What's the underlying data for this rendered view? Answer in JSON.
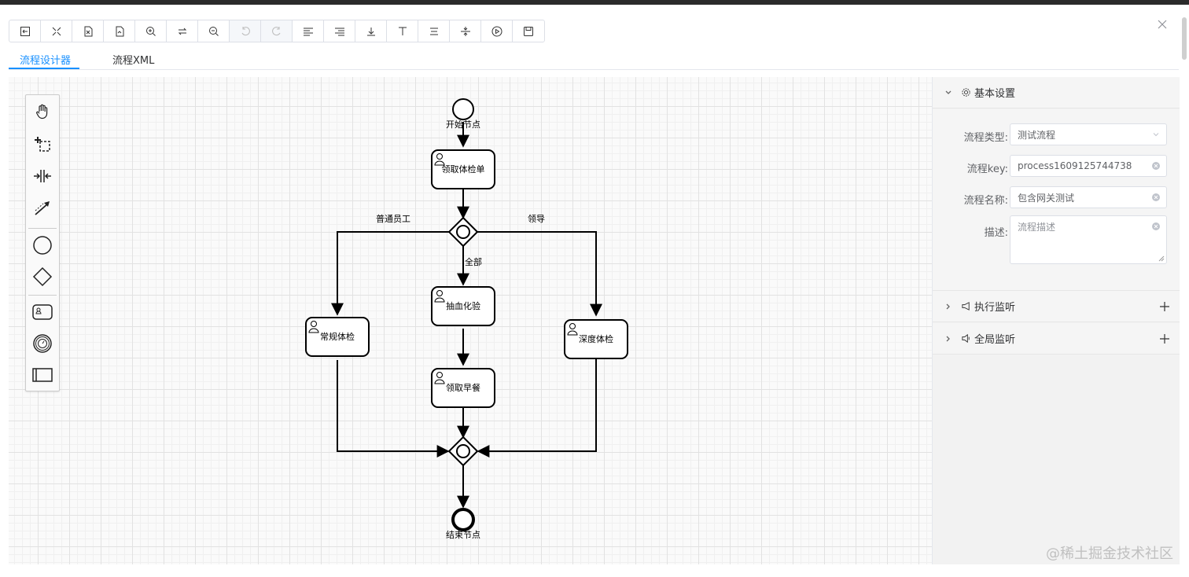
{
  "toolbar": {
    "buttons": [
      {
        "icon": "open-file-icon",
        "disabled": false
      },
      {
        "icon": "fit-view-icon",
        "disabled": false
      },
      {
        "icon": "download-xml-icon",
        "disabled": false
      },
      {
        "icon": "download-svg-icon",
        "disabled": false
      },
      {
        "icon": "zoom-in-icon",
        "disabled": false
      },
      {
        "icon": "reset-zoom-icon",
        "disabled": false
      },
      {
        "icon": "zoom-out-icon",
        "disabled": false
      },
      {
        "icon": "undo-icon",
        "disabled": true
      },
      {
        "icon": "redo-icon",
        "disabled": true
      },
      {
        "icon": "align-left-icon",
        "disabled": false
      },
      {
        "icon": "align-right-icon",
        "disabled": false
      },
      {
        "icon": "align-bottom-icon",
        "disabled": false
      },
      {
        "icon": "align-top-icon",
        "disabled": false
      },
      {
        "icon": "align-center-icon",
        "disabled": false
      },
      {
        "icon": "align-middle-icon",
        "disabled": false
      },
      {
        "icon": "simulate-icon",
        "disabled": false
      },
      {
        "icon": "save-icon",
        "disabled": false
      }
    ]
  },
  "tabs": {
    "designer": "流程设计器",
    "xml": "流程XML"
  },
  "diagram": {
    "start_label": "开始节点",
    "end_label": "结束节点",
    "tasks": {
      "get_form": "领取体检单",
      "blood_test": "抽血化验",
      "breakfast": "领取早餐",
      "regular": "常规体检",
      "deep": "深度体检"
    },
    "flows": {
      "employee": "普通员工",
      "leader": "领导",
      "all": "全部"
    }
  },
  "panel": {
    "basic": {
      "title": "基本设置",
      "type_label": "流程类型:",
      "type_value": "测试流程",
      "key_label": "流程key:",
      "key_value": "process1609125744738",
      "name_label": "流程名称:",
      "name_value": "包含网关测试",
      "desc_label": "描述:",
      "desc_placeholder": "流程描述"
    },
    "exec_listener": "执行监听",
    "global_listener": "全局监听"
  },
  "watermark": "@稀土掘金技术社区"
}
